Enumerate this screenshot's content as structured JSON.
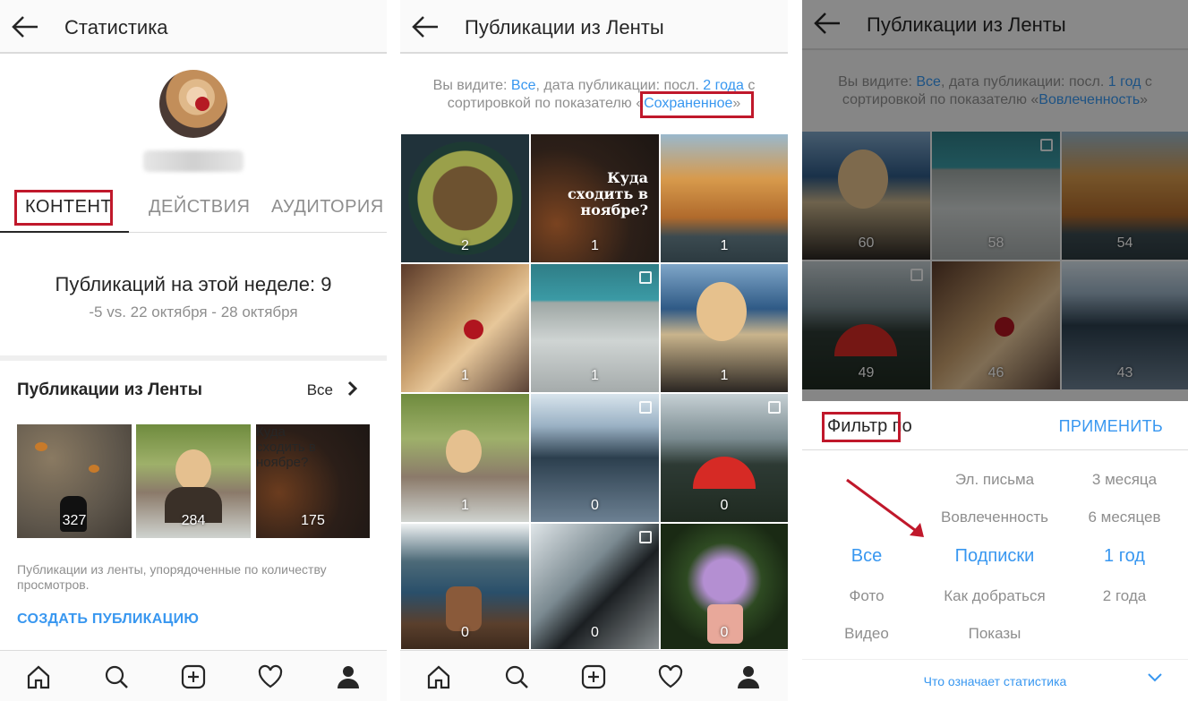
{
  "screen1": {
    "title": "Статистика",
    "tabs": [
      "КОНТЕНТ",
      "ДЕЙСТВИЯ",
      "АУДИТОРИЯ"
    ],
    "week_heading": "Публикаций на этой неделе: 9",
    "week_sub": "-5 vs. 22 октября - 28 октября",
    "feed_heading": "Публикации из Ленты",
    "feed_all": "Все",
    "thumb_counts": [
      "327",
      "284",
      "175"
    ],
    "thumb_text": "Куда сходить в ноябре?",
    "note": "Публикации из ленты, упорядоченные по количеству просмотров.",
    "create": "СОЗДАТЬ ПУБЛИКАЦИЮ"
  },
  "screen2": {
    "title": "Публикации из Ленты",
    "info_prefix": "Вы видите: ",
    "info_all": "Все",
    "info_mid": ", дата публикации: посл. ",
    "info_period": "2 года",
    "info_mid2": " с сортировкой по показателю «",
    "info_sort": "Сохраненное",
    "info_end": "»",
    "counts": [
      "2",
      "1",
      "1",
      "1",
      "1",
      "1",
      "1",
      "0",
      "0",
      "0",
      "0",
      "0"
    ],
    "thumb_text": "Куда сходить в ноябре?"
  },
  "screen3": {
    "title": "Публикации из Ленты",
    "info_prefix": "Вы видите: ",
    "info_all": "Все",
    "info_mid": ", дата публикации: посл. ",
    "info_period": "1 год",
    "info_mid2": " с сортировкой по показателю «",
    "info_sort": "Вовлеченность",
    "info_end": "»",
    "counts": [
      "60",
      "58",
      "54",
      "49",
      "46",
      "43"
    ],
    "filter_label": "Фильтр по",
    "apply": "ПРИМЕНИТЬ",
    "col1": [
      "Все",
      "Фото",
      "Видео"
    ],
    "col2": [
      "Эл. письма",
      "Вовлеченность",
      "Подписки",
      "Как добраться",
      "Показы"
    ],
    "col3": [
      "3 месяца",
      "6 месяцев",
      "1 год",
      "2 года"
    ],
    "what": "Что означает статистика"
  },
  "colors": {
    "accent": "#3897f0",
    "highlight": "#c0182b"
  }
}
